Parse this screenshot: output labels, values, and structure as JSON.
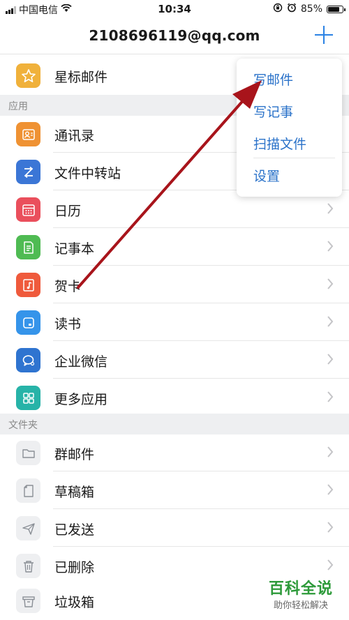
{
  "status_bar": {
    "carrier": "中国电信",
    "time": "10:34",
    "battery": "85%",
    "battery_level": 0.85
  },
  "header": {
    "title": "2108696119@qq.com",
    "add_icon": "plus-icon"
  },
  "starred": {
    "label": "星标邮件",
    "icon": "star-icon",
    "color": "#f0b13b"
  },
  "apps_section": {
    "title": "应用",
    "items": [
      {
        "label": "通讯录",
        "icon": "contacts-icon",
        "color": "#ef9233"
      },
      {
        "label": "文件中转站",
        "icon": "file-transfer-icon",
        "color": "#3b76d6"
      },
      {
        "label": "日历",
        "icon": "calendar-icon",
        "color": "#ea4f5c"
      },
      {
        "label": "记事本",
        "icon": "notepad-icon",
        "color": "#4fbb53"
      },
      {
        "label": "贺卡",
        "icon": "greeting-card-icon",
        "color": "#ef5a3c"
      },
      {
        "label": "读书",
        "icon": "book-icon",
        "color": "#3594ea"
      },
      {
        "label": "企业微信",
        "icon": "wecom-icon",
        "color": "#2f74d0"
      },
      {
        "label": "更多应用",
        "icon": "more-apps-icon",
        "color": "#27b3a8"
      }
    ]
  },
  "folders_section": {
    "title": "文件夹",
    "items": [
      {
        "label": "群邮件",
        "icon": "folder-icon"
      },
      {
        "label": "草稿箱",
        "icon": "draft-icon"
      },
      {
        "label": "已发送",
        "icon": "send-icon"
      },
      {
        "label": "已删除",
        "icon": "trash-icon"
      },
      {
        "label": "垃圾箱",
        "icon": "junk-icon"
      }
    ]
  },
  "popup_menu": {
    "items": [
      {
        "label": "写邮件"
      },
      {
        "label": "写记事"
      },
      {
        "label": "扫描文件"
      },
      {
        "label": "设置"
      }
    ]
  },
  "watermark": {
    "brand": "百科全说",
    "tagline": "助你轻松解决"
  },
  "colors": {
    "accent": "#2a82e4",
    "menu_text": "#2a72c9",
    "arrow": "#a8141b",
    "section_bg": "#eeeff1"
  }
}
